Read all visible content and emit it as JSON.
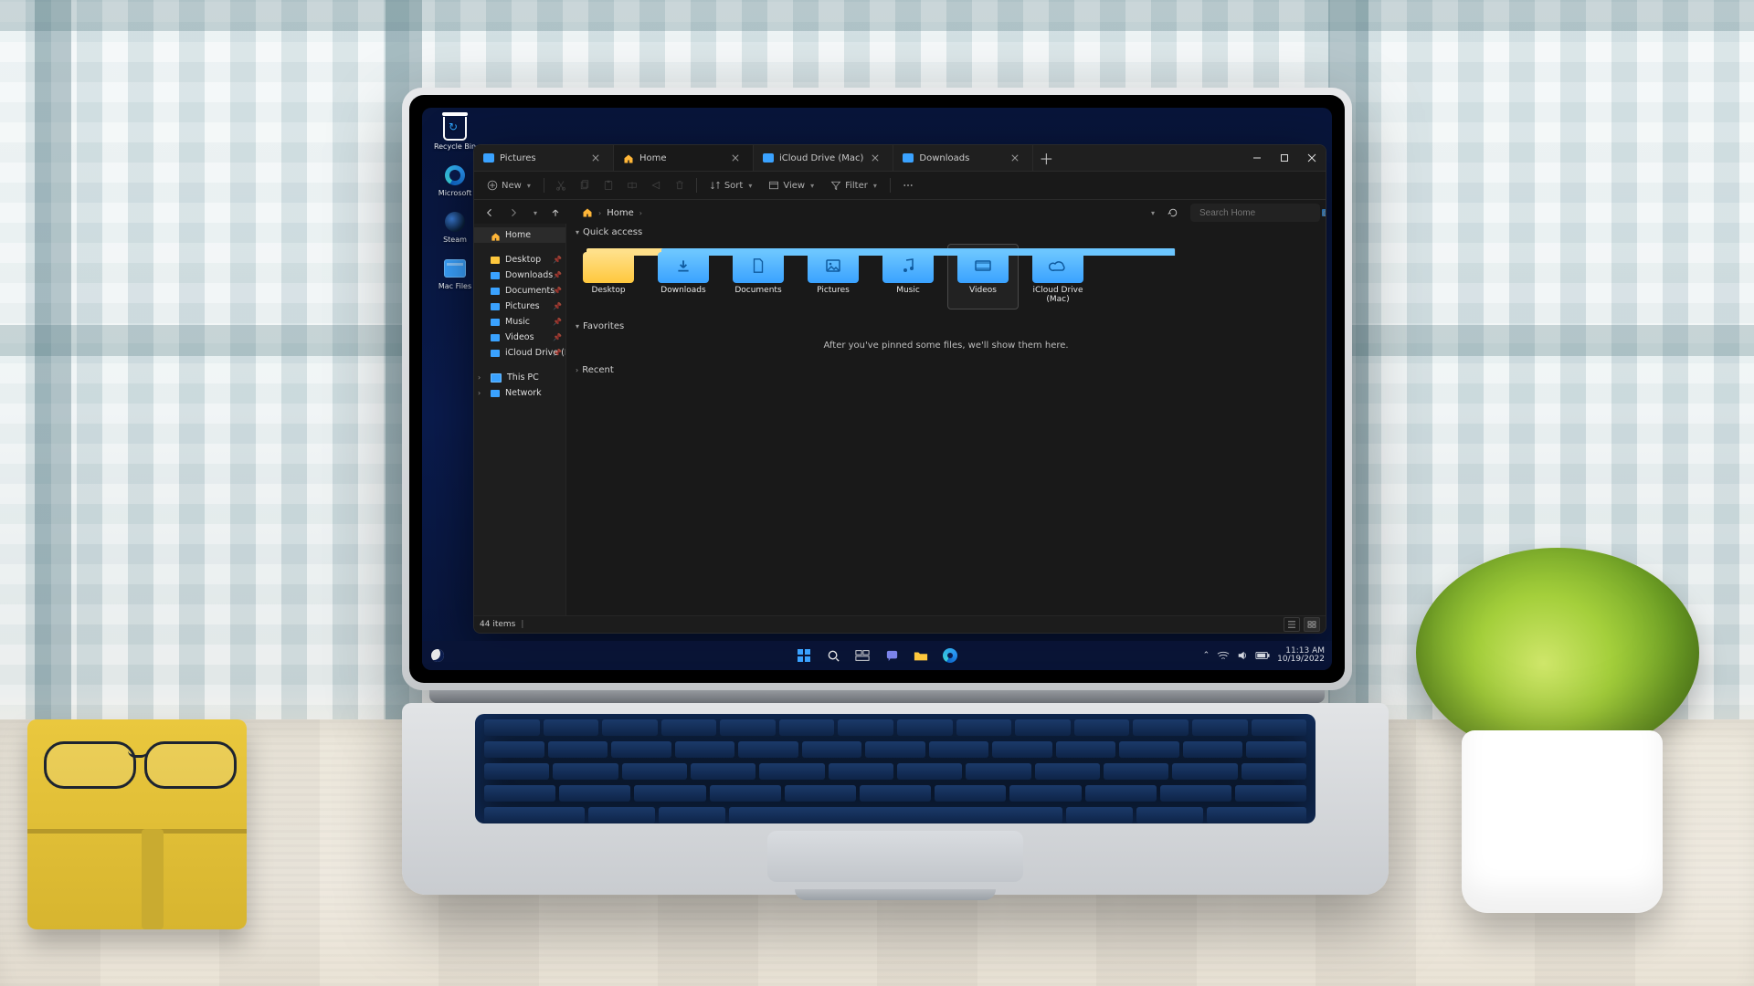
{
  "domain": "Computer-Use",
  "desktop_icons": [
    {
      "name": "Recycle Bin",
      "icon": "recycle-bin-icon"
    },
    {
      "name": "Microsoft",
      "icon": "edge-icon"
    },
    {
      "name": "Steam",
      "icon": "steam-icon"
    },
    {
      "name": "Mac Files",
      "icon": "folder-icon"
    }
  ],
  "explorer": {
    "tabs": [
      {
        "label": "Pictures",
        "active": false,
        "icon": "folder"
      },
      {
        "label": "Home",
        "active": true,
        "icon": "home"
      },
      {
        "label": "iCloud Drive (Mac)",
        "active": false,
        "icon": "folder"
      },
      {
        "label": "Downloads",
        "active": false,
        "icon": "folder"
      }
    ],
    "toolbar": {
      "new": "New",
      "sort": "Sort",
      "view": "View",
      "filter": "Filter"
    },
    "nav": {
      "back": "Back",
      "forward": "Forward",
      "up": "Up",
      "refresh": "Refresh",
      "search_placeholder": "Search Home"
    },
    "breadcrumbs": [
      "Home"
    ],
    "sidebar": {
      "home": "Home",
      "quick": [
        {
          "label": "Desktop",
          "icon": "desktop"
        },
        {
          "label": "Downloads",
          "icon": "folder"
        },
        {
          "label": "Documents",
          "icon": "folder"
        },
        {
          "label": "Pictures",
          "icon": "folder"
        },
        {
          "label": "Music",
          "icon": "folder"
        },
        {
          "label": "Videos",
          "icon": "folder"
        },
        {
          "label": "iCloud Drive (Mac)",
          "icon": "folder"
        }
      ],
      "this_pc": "This PC",
      "network": "Network"
    },
    "sections": {
      "quick_access": "Quick access",
      "favorites": "Favorites",
      "favorites_empty": "After you've pinned some files, we'll show them here.",
      "recent": "Recent"
    },
    "quick_access_cards": [
      {
        "label": "Desktop",
        "icon": "desktop"
      },
      {
        "label": "Downloads",
        "icon": "download"
      },
      {
        "label": "Documents",
        "icon": "document"
      },
      {
        "label": "Pictures",
        "icon": "picture"
      },
      {
        "label": "Music",
        "icon": "music"
      },
      {
        "label": "Videos",
        "icon": "video",
        "selected": true
      },
      {
        "label": "iCloud Drive (Mac)",
        "icon": "cloud"
      }
    ],
    "status": {
      "count": "44 items"
    }
  },
  "taskbar": {
    "apps": [
      "start",
      "search",
      "task-view",
      "chat",
      "explorer",
      "edge"
    ],
    "tray": {
      "time": "11:13 AM",
      "date": "10/19/2022"
    }
  },
  "colors": {
    "accent": "#3aa2ff",
    "folder_yellow": "#ffc83d",
    "bg_dark": "#191919"
  }
}
